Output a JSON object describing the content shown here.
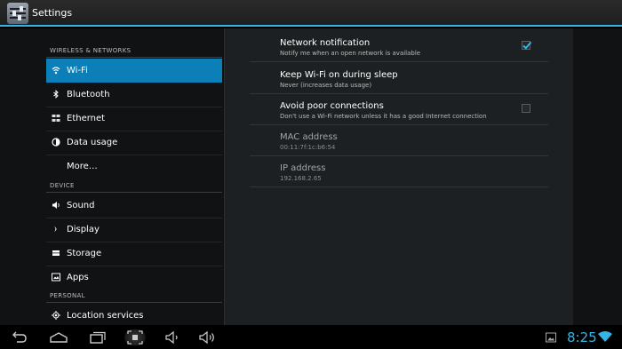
{
  "app": {
    "title": "Settings"
  },
  "sidebar": {
    "sections": [
      {
        "header": "WIRELESS & NETWORKS"
      },
      {
        "header": "DEVICE"
      },
      {
        "header": "PERSONAL"
      }
    ],
    "items": [
      {
        "label": "Wi-Fi",
        "icon": "wifi-icon",
        "selected": true
      },
      {
        "label": "Bluetooth",
        "icon": "bluetooth-icon"
      },
      {
        "label": "Ethernet",
        "icon": "ethernet-icon"
      },
      {
        "label": "Data usage",
        "icon": "data-usage-icon"
      },
      {
        "label": "More…",
        "icon": ""
      },
      {
        "label": "Sound",
        "icon": "sound-icon"
      },
      {
        "label": "Display",
        "icon": "display-icon"
      },
      {
        "label": "Storage",
        "icon": "storage-icon"
      },
      {
        "label": "Apps",
        "icon": "apps-icon"
      },
      {
        "label": "Location services",
        "icon": "location-icon"
      }
    ]
  },
  "prefs": [
    {
      "title": "Network notification",
      "summary": "Notify me when an open network is available",
      "checkbox": true,
      "checked": true
    },
    {
      "title": "Keep Wi-Fi on during sleep",
      "summary": "Never (increases data usage)"
    },
    {
      "title": "Avoid poor connections",
      "summary": "Don't use a Wi-Fi network unless it has a good Internet connection",
      "checkbox": true,
      "checked": false
    },
    {
      "title": "MAC address",
      "summary": "00:11:7f:1c:b6:54",
      "disabled": true
    },
    {
      "title": "IP address",
      "summary": "192.168.2.65",
      "disabled": true
    }
  ],
  "statusbar": {
    "time": "8:25"
  },
  "colors": {
    "accent": "#33b5e5",
    "selected": "#0d7fb8"
  }
}
